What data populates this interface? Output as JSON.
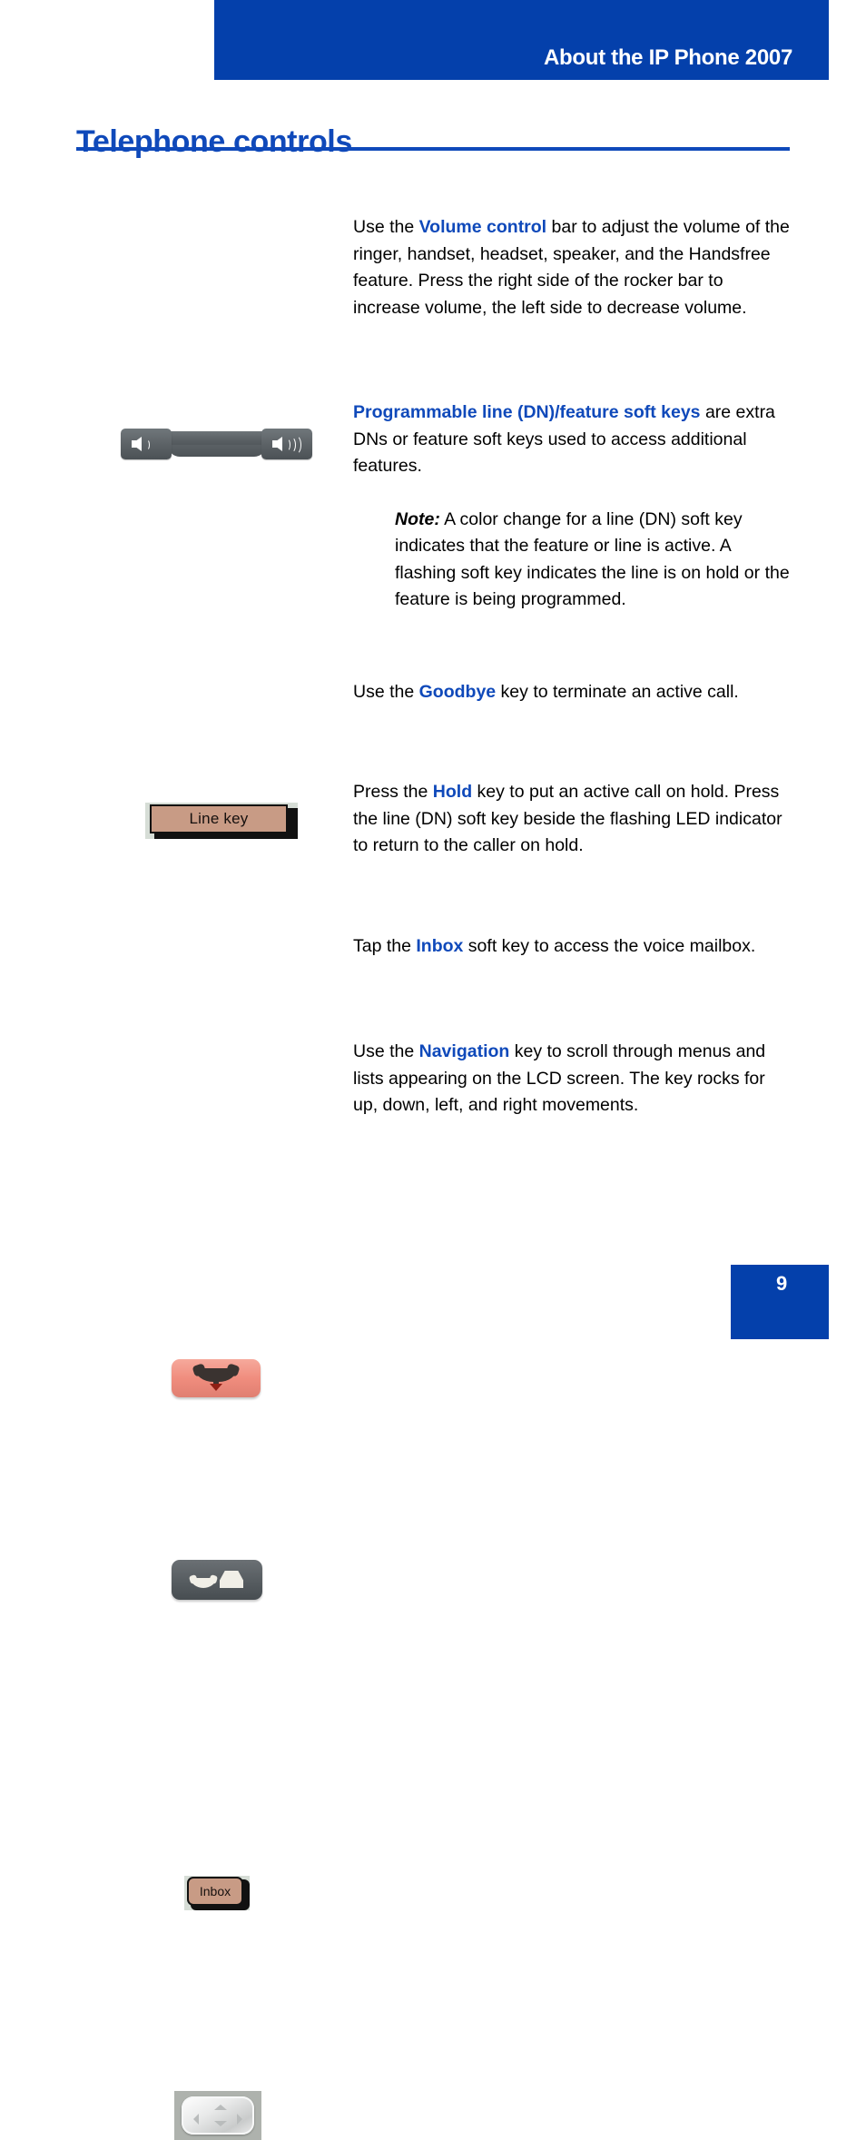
{
  "header": {
    "running_head": "About the IP Phone 2007"
  },
  "page": {
    "title": "Telephone controls",
    "number": "9"
  },
  "sections": [
    {
      "art": "volume-rocker-art",
      "art_label": "Volume control rocker bar",
      "text_lead": "Use the ",
      "accent": "Volume control",
      "text_tail": " bar to adjust the volume of the ringer, handset, headset, speaker, and the Handsfree feature. Press the right side of the rocker bar to increase volume, the left side to decrease volume."
    },
    {
      "art": "line-key-art",
      "art_label": "Line key",
      "text_lead": "",
      "accent": "Programmable line (DN)/feature soft keys",
      "text_tail": " are extra DNs or feature soft keys used to access additional features.",
      "note_label": "Note:",
      "note_text": " A color change for a line (DN) soft key indicates that the feature or line is active. A flashing soft key indicates the line is on hold or the feature is being programmed."
    },
    {
      "art": "goodbye-key-art",
      "art_label": "Goodbye key",
      "text_lead": "Use the ",
      "accent": "Goodbye",
      "text_tail": " key to terminate an active call."
    },
    {
      "art": "hold-key-art",
      "art_label": "Hold key",
      "text_lead": "Press the ",
      "accent": "Hold",
      "text_tail": " key to put an active call on hold. Press the line (DN) soft key beside the flashing LED indicator to return to the caller on hold."
    },
    {
      "art": "inbox-key-art",
      "art_label": "Inbox",
      "text_lead": "Tap the ",
      "accent": "Inbox",
      "text_tail": " soft key to access the voice mailbox."
    },
    {
      "art": "navigation-key-art",
      "art_label": "Navigation key",
      "text_lead": "Use the ",
      "accent": "Navigation",
      "text_tail": " key to scroll through menus and lists appearing on the LCD screen. The key rocks for up, down, left, and right movements."
    }
  ],
  "colors": {
    "brand_blue": "#0440ab",
    "title_blue": "#0f49ba",
    "key_tan": "#c89b85",
    "key_gray": "#585e62",
    "key_salmon": "#f08d7e"
  }
}
